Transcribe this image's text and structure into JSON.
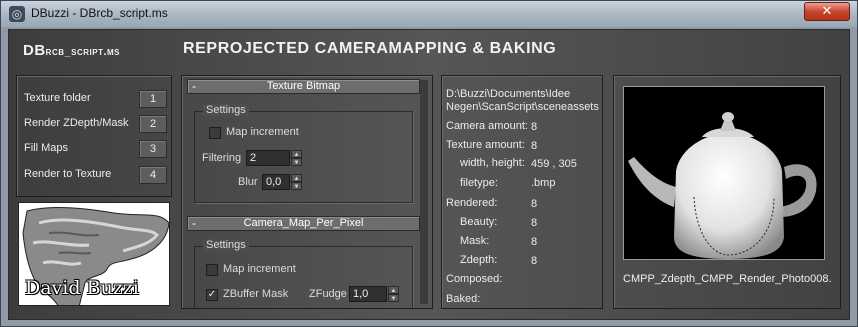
{
  "window": {
    "title": "DBuzzi - DBrcb_script.ms",
    "close_glyph": "✕"
  },
  "header": {
    "script_name_prefix": "DB",
    "script_name_rest": "rcb_script.ms",
    "main_title": "REPROJECTED CAMERAMAPPING & BAKING"
  },
  "steps": [
    {
      "label": "Texture folder",
      "button": "1"
    },
    {
      "label": "Render ZDepth/Mask",
      "button": "2"
    },
    {
      "label": "Fill Maps",
      "button": "3"
    },
    {
      "label": "Render to Texture",
      "button": "4"
    }
  ],
  "logo": {
    "name": "David Buzzi"
  },
  "texture_bitmap": {
    "title": "Texture Bitmap",
    "collapse_glyph": "-",
    "group_title": "Settings",
    "map_increment_label": "Map increment",
    "map_increment_checked": false,
    "filtering_label": "Filtering",
    "filtering_value": "2",
    "blur_label": "Blur",
    "blur_value": "0,0"
  },
  "camera_map": {
    "title": "Camera_Map_Per_Pixel",
    "collapse_glyph": "-",
    "group_title": "Settings",
    "map_increment_label": "Map increment",
    "map_increment_checked": false,
    "zbuffer_label": "ZBuffer Mask",
    "zbuffer_checked": true,
    "check_glyph": "✓",
    "zfudge_label": "ZFudge",
    "zfudge_value": "1,0"
  },
  "info": {
    "path_line1": "D:\\Buzzi\\Documents\\Idee",
    "path_line2": "Negen\\ScanScript\\sceneassets",
    "camera_amount_label": "Camera amount:",
    "camera_amount": "8",
    "texture_amount_label": "Texture amount:",
    "texture_amount": "8",
    "wh_label": "width, height:",
    "wh_value": "459 , 305",
    "filetype_label": "filetype:",
    "filetype_value": ".bmp",
    "rendered_label": "Rendered:",
    "rendered_value": "8",
    "beauty_label": "Beauty:",
    "beauty_value": "8",
    "mask_label": "Mask:",
    "mask_value": "8",
    "zdepth_label": "Zdepth:",
    "zdepth_value": "8",
    "composed_label": "Composed:",
    "baked_label": "Baked:"
  },
  "preview": {
    "caption": "CMPP_Zdepth_CMPP_Render_Photo008."
  }
}
